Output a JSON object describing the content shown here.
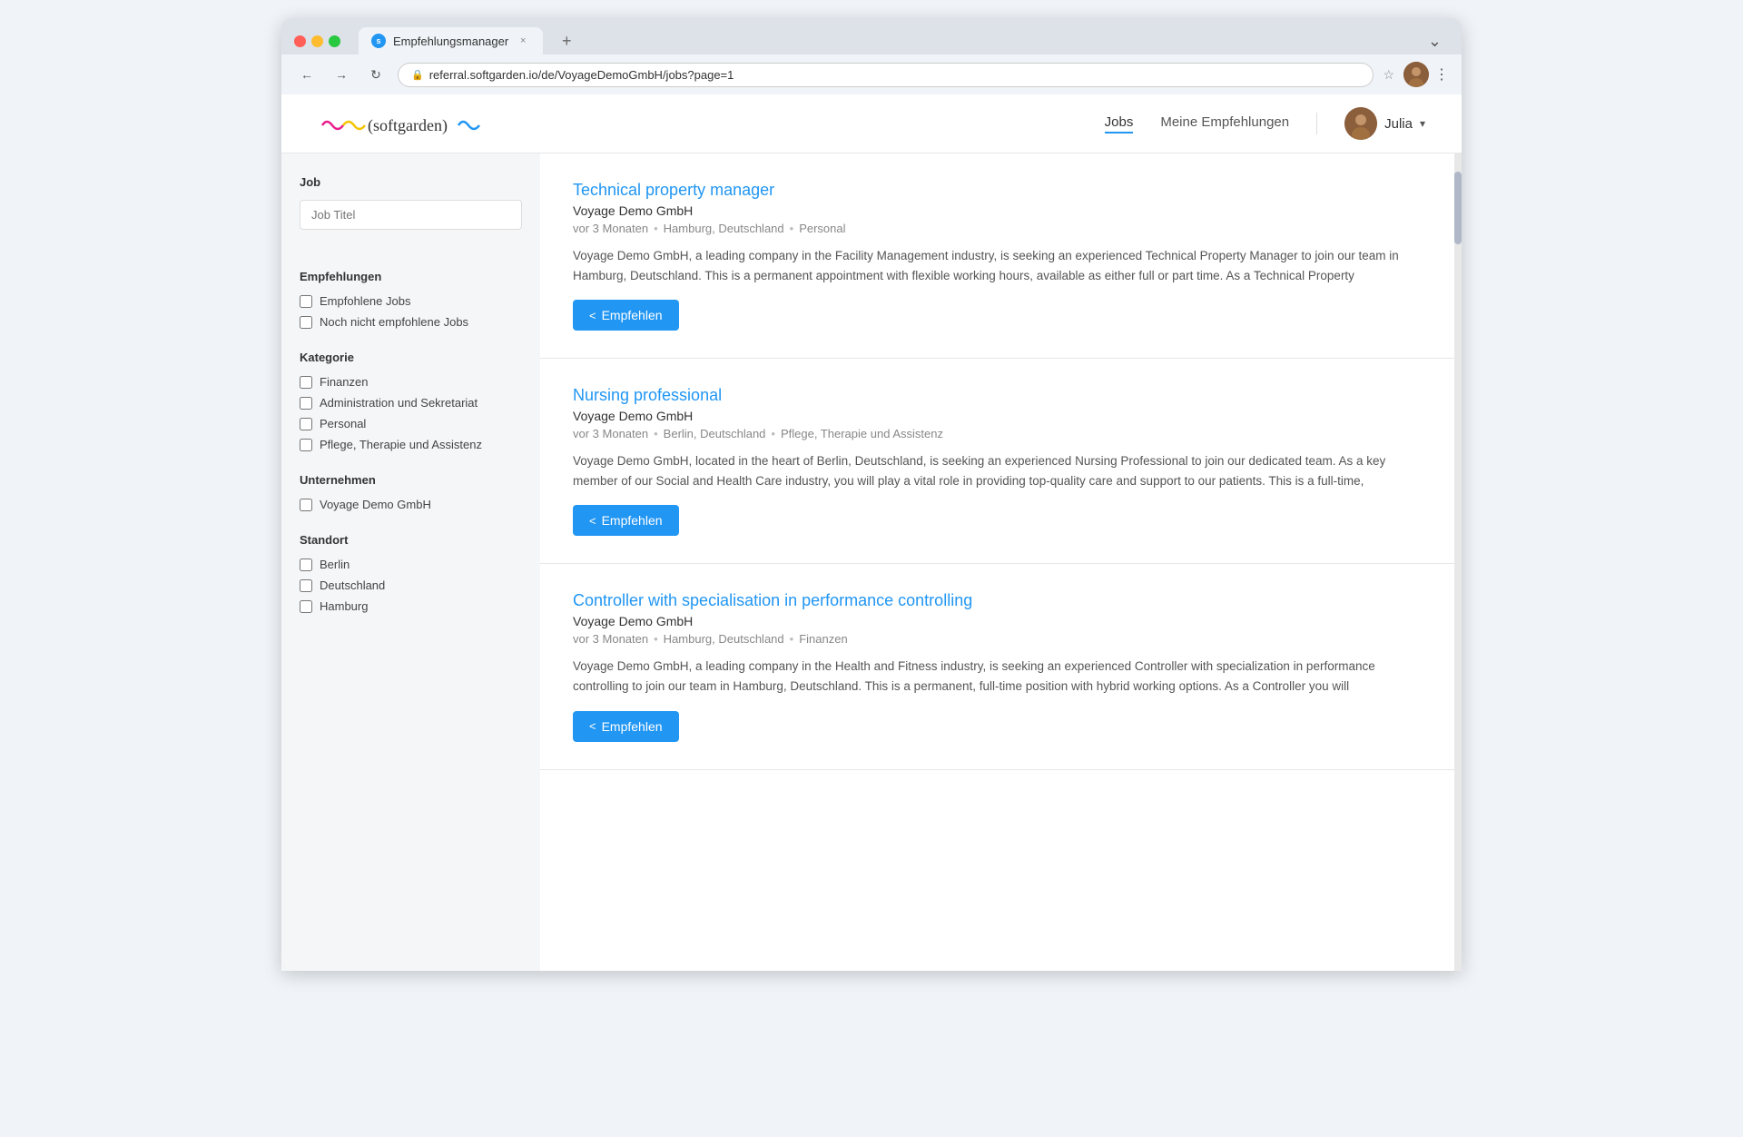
{
  "browser": {
    "tab_title": "Empfehlungsmanager",
    "tab_close": "×",
    "tab_add": "+",
    "url": "referral.softgarden.io/de/VoyageDemoGmbH/jobs?page=1",
    "menu_dots": "⋮",
    "chevron_down": "⌄"
  },
  "nav": {
    "logo_text": "(softgarden)",
    "links": [
      {
        "label": "Jobs",
        "active": true
      },
      {
        "label": "Meine Empfehlungen",
        "active": false
      }
    ],
    "user_name": "Julia",
    "user_chevron": "▾"
  },
  "sidebar": {
    "job_section_title": "Job",
    "job_placeholder": "Job Titel",
    "empfehlungen_title": "Empfehlungen",
    "empfehlungen_items": [
      {
        "label": "Empfohlene Jobs",
        "checked": false
      },
      {
        "label": "Noch nicht empfohlene Jobs",
        "checked": false
      }
    ],
    "kategorie_title": "Kategorie",
    "kategorie_items": [
      {
        "label": "Finanzen",
        "checked": false
      },
      {
        "label": "Administration und Sekretariat",
        "checked": false
      },
      {
        "label": "Personal",
        "checked": false
      },
      {
        "label": "Pflege, Therapie und Assistenz",
        "checked": false
      }
    ],
    "unternehmen_title": "Unternehmen",
    "unternehmen_items": [
      {
        "label": "Voyage Demo GmbH",
        "checked": false
      }
    ],
    "standort_title": "Standort",
    "standort_items": [
      {
        "label": "Berlin",
        "checked": false
      },
      {
        "label": "Deutschland",
        "checked": false
      },
      {
        "label": "Hamburg",
        "checked": false
      }
    ]
  },
  "jobs": [
    {
      "title": "Technical property manager",
      "company": "Voyage Demo GmbH",
      "time": "vor 3 Monaten",
      "location": "Hamburg, Deutschland",
      "category": "Personal",
      "description": "Voyage Demo GmbH, a leading company in the Facility Management industry, is seeking an experienced Technical Property Manager to join our team in Hamburg, Deutschland. This is a permanent appointment with flexible working hours, available as either full or part time. As a Technical Property",
      "btn_label": "Empfehlen"
    },
    {
      "title": "Nursing professional",
      "company": "Voyage Demo GmbH",
      "time": "vor 3 Monaten",
      "location": "Berlin, Deutschland",
      "category": "Pflege, Therapie und Assistenz",
      "description": "Voyage Demo GmbH, located in the heart of Berlin, Deutschland, is seeking an experienced Nursing Professional to join our dedicated team. As a key member of our Social and Health Care industry, you will play a vital role in providing top-quality care and support to our patients. This is a full-time,",
      "btn_label": "Empfehlen"
    },
    {
      "title": "Controller with specialisation in performance controlling",
      "company": "Voyage Demo GmbH",
      "time": "vor 3 Monaten",
      "location": "Hamburg, Deutschland",
      "category": "Finanzen",
      "description": "Voyage Demo GmbH, a leading company in the Health and Fitness industry, is seeking an experienced Controller with specialization in performance controlling to join our team in Hamburg, Deutschland. This is a permanent, full-time position with hybrid working options. As a Controller you will",
      "btn_label": "Empfehlen"
    }
  ],
  "colors": {
    "accent": "#2196F3",
    "link": "#2196F3"
  }
}
